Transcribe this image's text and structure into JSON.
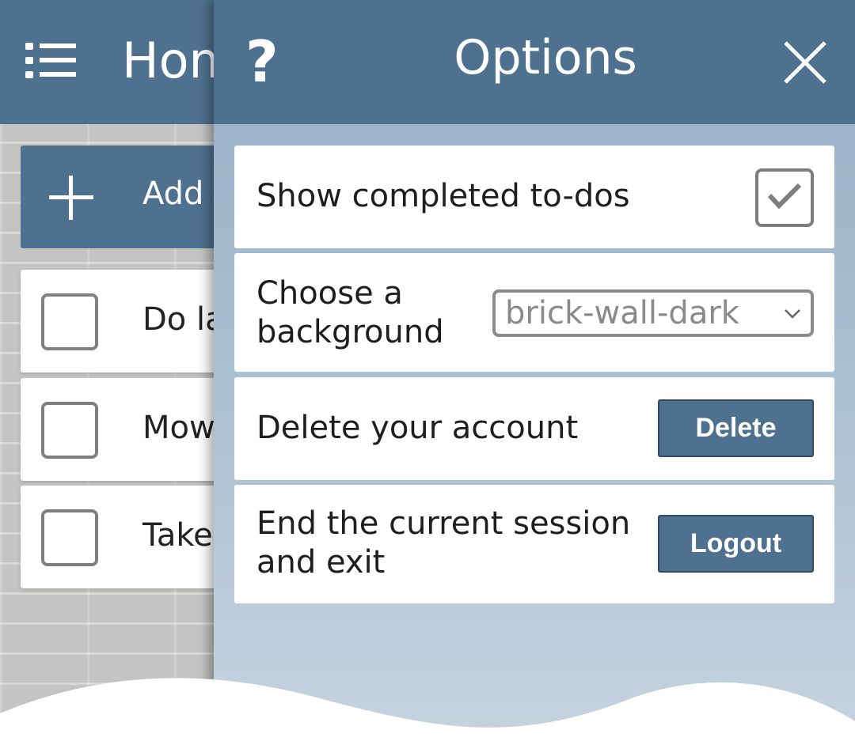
{
  "home": {
    "title": "Home",
    "add_label": "Add a to-do",
    "todos": [
      {
        "label": "Do laundry"
      },
      {
        "label": "Mow the lawn"
      },
      {
        "label": "Take out trash"
      }
    ]
  },
  "options": {
    "help_label": "?",
    "title": "Options",
    "rows": {
      "show_completed": {
        "label": "Show completed to-dos",
        "checked": true
      },
      "background": {
        "label": "Choose a background",
        "selected": "brick-wall-dark"
      },
      "delete_account": {
        "label": "Delete your account",
        "button": "Delete"
      },
      "logout": {
        "label": "End the current session and exit",
        "button": "Logout"
      }
    }
  },
  "icons": {
    "menu": "menu-list-icon",
    "add": "plus-icon",
    "help": "question-icon",
    "close": "close-icon",
    "check": "checkmark-icon",
    "dropdown": "chevron-down-icon"
  },
  "colors": {
    "header": "#4f7190",
    "panel_top": "#94adc4",
    "panel_bottom": "#c7d3df",
    "button": "#4f7190",
    "button_border": "#2f4b63"
  }
}
